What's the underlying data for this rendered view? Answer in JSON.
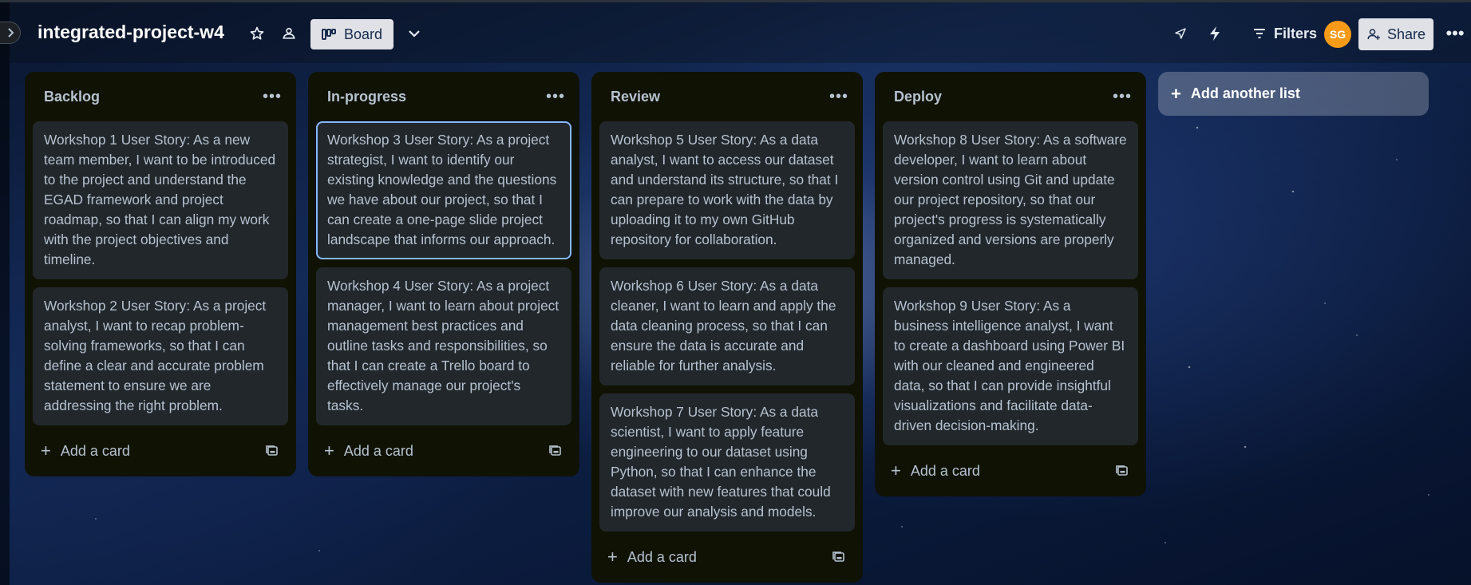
{
  "header": {
    "board_title": "integrated-project-w4",
    "view_label": "Board",
    "filters_label": "Filters",
    "avatar_initials": "SG",
    "share_label": "Share"
  },
  "lists": [
    {
      "title": "Backlog",
      "add_card_label": "Add a card",
      "cards": [
        "Workshop 1 User Story: As a new team member, I want to be introduced to the project and understand the EGAD framework and project roadmap, so that I can align my work with the project objectives and timeline.",
        "Workshop 2 User Story: As a project analyst, I want to recap problem-solving frameworks, so that I can define a clear and accurate problem statement to ensure we are addressing the right problem."
      ]
    },
    {
      "title": "In-progress",
      "add_card_label": "Add a card",
      "cards": [
        "Workshop 3 User Story: As a project strategist, I want to identify our existing knowledge and the questions we have about our project, so that I can create a one-page slide project landscape that informs our approach.",
        "Workshop 4 User Story: As a project manager, I want to learn about project management best practices and outline tasks and responsibilities, so that I can create a Trello board to effectively manage our project's tasks."
      ]
    },
    {
      "title": "Review",
      "add_card_label": "Add a card",
      "cards": [
        "Workshop 5 User Story: As a data analyst, I want to access our dataset and understand its structure, so that I can prepare to work with the data by uploading it to my own GitHub repository for collaboration.",
        "Workshop 6 User Story: As a data cleaner, I want to learn and apply the data cleaning process, so that I can ensure the data is accurate and reliable for further analysis.",
        "Workshop 7 User Story: As a data scientist, I want to apply feature engineering to our dataset using Python, so that I can enhance the dataset with new features that could improve our analysis and models."
      ]
    },
    {
      "title": "Deploy",
      "add_card_label": "Add a card",
      "cards": [
        "Workshop 8 User Story: As a software developer, I want to learn about version control using Git and update our project repository, so that our project's progress is systematically organized and versions are properly managed.",
        "Workshop 9 User Story: As a business intelligence analyst, I want to create a dashboard using Power BI with our cleaned and engineered data, so that I can provide insightful visualizations and facilitate data-driven decision-making."
      ]
    }
  ],
  "add_list_label": "Add another list",
  "colors": {
    "list_bg": "#101204",
    "card_bg": "#22272b",
    "text": "#b6c2cf",
    "avatar": "#f79a18",
    "selected_border": "#85b8ff"
  }
}
